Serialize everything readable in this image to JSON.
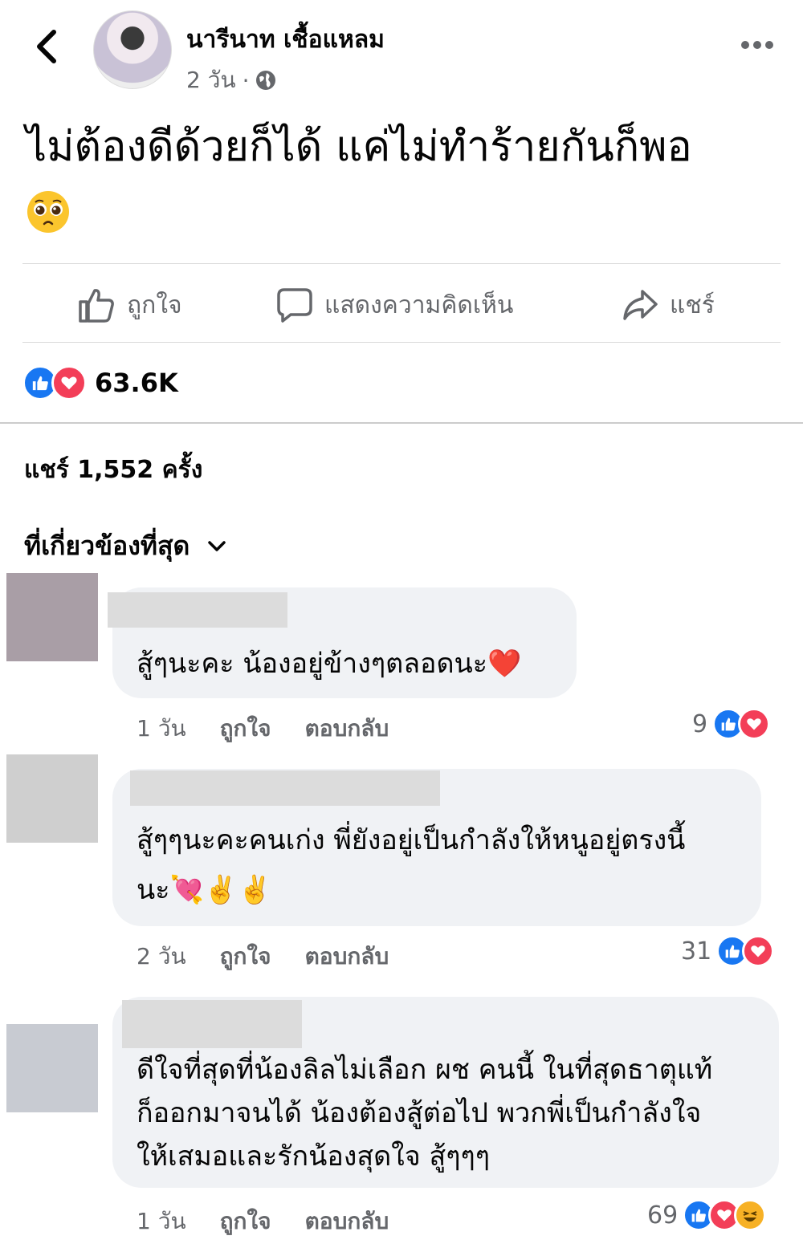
{
  "header": {
    "author": "นารีนาท เชื้อแหลม",
    "time": "2 วัน",
    "separator": "·"
  },
  "post": {
    "text": "ไม่ต้องดีด้วยก็ได้ แค่ไม่ทำร้ายกันก็พอ",
    "emoji": "pleading-face"
  },
  "actions": {
    "like": "ถูกใจ",
    "comment": "แสดงความคิดเห็น",
    "share": "แชร์"
  },
  "reactions": {
    "count": "63.6K",
    "types": [
      "like",
      "love"
    ]
  },
  "shares": "แชร์ 1,552 ครั้ง",
  "sort": {
    "label": "ที่เกี่ยวข้องที่สุด"
  },
  "comments": [
    {
      "text": "สู้ๆนะคะ น้องอยู่ข้างๆตลอดนะ❤️",
      "time": "1 วัน",
      "like": "ถูกใจ",
      "reply": "ตอบกลับ",
      "reaction_count": "9",
      "reaction_types": [
        "like",
        "love"
      ]
    },
    {
      "text": "สู้ๆๆนะคะคนเก่ง พี่ยังอยู่เป็นกำลังให้หนูอยู่ตรงนี้",
      "text2": "นะ💘✌️✌️",
      "time": "2 วัน",
      "like": "ถูกใจ",
      "reply": "ตอบกลับ",
      "reaction_count": "31",
      "reaction_types": [
        "like",
        "love"
      ]
    },
    {
      "text": "ดีใจที่สุดที่น้องลิลไม่เลือก ผช คนนี้ ในที่สุดธาตุแท้",
      "text2": "ก็ออกมาจนได้ น้องต้องสู้ต่อไป พวกพี่เป็นกำลังใจ",
      "text3": "ให้เสมอและรักน้องสุดใจ สู้ๆๆๆ",
      "time": "1 วัน",
      "like": "ถูกใจ",
      "reply": "ตอบกลับ",
      "reaction_count": "69",
      "reaction_types": [
        "like",
        "love",
        "haha"
      ]
    }
  ]
}
